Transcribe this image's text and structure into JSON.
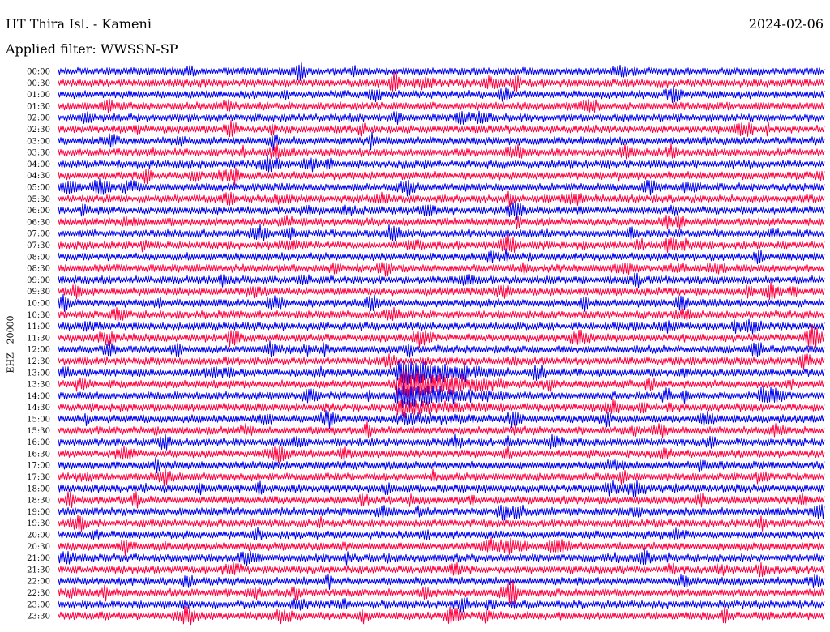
{
  "header": {
    "station": "HT Thira Isl. - Kameni",
    "date": "2024-02-06",
    "filter": "Applied filter: WWSSN-SP"
  },
  "chart_data": {
    "type": "helicorder",
    "ylabel": "EHZ - 20000",
    "row_labels": [
      "00:00",
      "00:30",
      "01:00",
      "01:30",
      "02:00",
      "02:30",
      "03:00",
      "03:30",
      "04:00",
      "04:30",
      "05:00",
      "05:30",
      "06:00",
      "06:30",
      "07:00",
      "07:30",
      "08:00",
      "08:30",
      "09:00",
      "09:30",
      "10:00",
      "10:30",
      "11:00",
      "11:30",
      "12:00",
      "12:30",
      "13:00",
      "13:30",
      "14:00",
      "14:30",
      "15:00",
      "15:30",
      "16:00",
      "16:30",
      "17:00",
      "17:30",
      "18:00",
      "18:30",
      "19:00",
      "19:30",
      "20:00",
      "20:30",
      "21:00",
      "21:30",
      "22:00",
      "22:30",
      "23:00",
      "23:30"
    ],
    "trace_colors": [
      "#0000ee",
      "#ff0040"
    ],
    "event": {
      "start_row": "13:00",
      "end_row": "15:00",
      "position": 0.45
    }
  }
}
